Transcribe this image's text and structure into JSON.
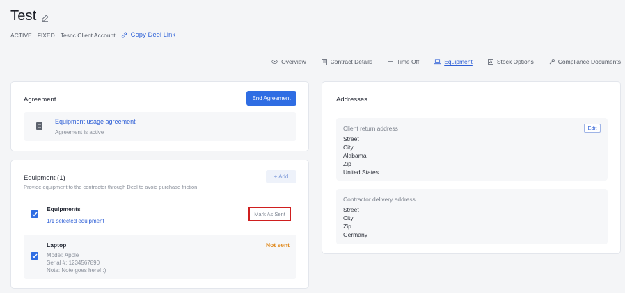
{
  "header": {
    "title": "Test",
    "status": "ACTIVE",
    "contract_type": "FIXED",
    "client": "Tesnc Client Account",
    "copy_link": "Copy Deel Link"
  },
  "tabs": [
    {
      "label": "Overview",
      "icon": "eye-icon"
    },
    {
      "label": "Contract Details",
      "icon": "document-icon"
    },
    {
      "label": "Time Off",
      "icon": "calendar-icon"
    },
    {
      "label": "Equipment",
      "icon": "laptop-icon",
      "active": true
    },
    {
      "label": "Stock Options",
      "icon": "chart-icon"
    },
    {
      "label": "Compliance Documents",
      "icon": "wrench-icon"
    }
  ],
  "agreement": {
    "title": "Agreement",
    "end_button": "End Agreement",
    "doc_name": "Equipment usage agreement",
    "doc_status": "Agreement is active"
  },
  "equipment": {
    "title": "Equipment (1)",
    "description": "Provide equipment to the contractor through Deel to avoid purchase friction",
    "add_button": "+ Add",
    "group": {
      "name": "Equipments",
      "selection": "1/1 selected equipment",
      "mark_button": "Mark As Sent"
    },
    "items": [
      {
        "name": "Laptop",
        "status": "Not sent",
        "model": "Model: Apple",
        "serial": "Serial #: 1234567890",
        "note": "Note: Note goes here! :)"
      }
    ]
  },
  "addresses": {
    "title": "Addresses",
    "client_return": {
      "label": "Client return address",
      "edit_button": "Edit",
      "lines": [
        "Street",
        "City",
        "Alabama",
        "Zip",
        "United States"
      ]
    },
    "contractor_delivery": {
      "label": "Contractor delivery address",
      "lines": [
        "Street",
        "City",
        "Zip",
        "Germany"
      ]
    }
  },
  "colors": {
    "primary": "#2f6de3",
    "link": "#2e5fd6",
    "warning": "#e08a1e",
    "highlight": "#cf1f1f"
  }
}
